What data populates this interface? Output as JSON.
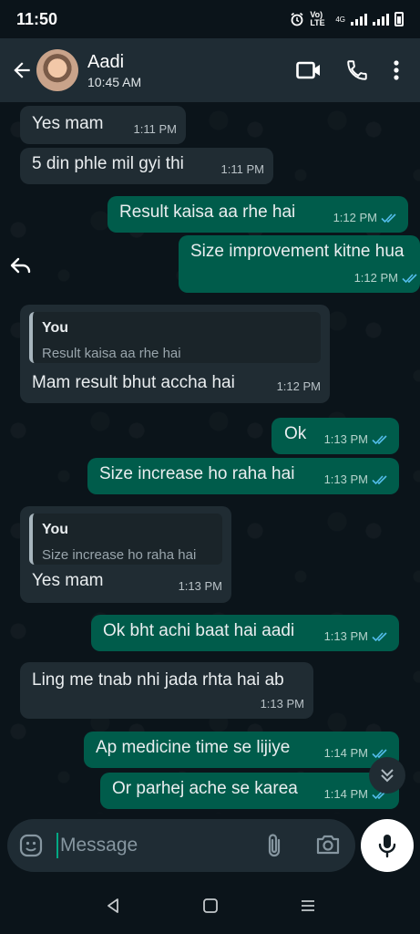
{
  "status_bar": {
    "time": "11:50",
    "network_label": "Vo) LTE",
    "network_type": "4G"
  },
  "header": {
    "contact_name": "Aadi",
    "last_seen": "10:45 AM"
  },
  "messages": [
    {
      "dir": "in",
      "text": "Yes mam",
      "time": "1:11 PM"
    },
    {
      "dir": "in",
      "text": "5 din phle mil gyi thi",
      "time": "1:11 PM"
    },
    {
      "dir": "out",
      "text": "Result kaisa aa rhe hai",
      "time": "1:12 PM",
      "read": true
    },
    {
      "dir": "out",
      "text": "Size improvement kitne hua",
      "time": "1:12 PM",
      "read": true
    },
    {
      "dir": "in",
      "quote_author": "You",
      "quote_text": "Result kaisa aa rhe hai",
      "text": "Mam result bhut accha hai",
      "time": "1:12 PM"
    },
    {
      "dir": "out",
      "text": "Ok",
      "time": "1:13 PM",
      "read": true
    },
    {
      "dir": "out",
      "text": "Size increase ho raha hai",
      "time": "1:13 PM",
      "read": true
    },
    {
      "dir": "in",
      "quote_author": "You",
      "quote_text": "Size increase ho raha hai",
      "text": "Yes mam",
      "time": "1:13 PM"
    },
    {
      "dir": "out",
      "text": "Ok bht achi baat hai aadi",
      "time": "1:13 PM",
      "read": true
    },
    {
      "dir": "in",
      "text": "Ling me tnab nhi jada rhta hai ab",
      "time": "1:13 PM"
    },
    {
      "dir": "out",
      "text": "Ap medicine time se lijiye",
      "time": "1:14 PM",
      "read": true
    },
    {
      "dir": "out",
      "text": "Or parhej ache se karea",
      "time": "1:14 PM",
      "read": true
    }
  ],
  "composer": {
    "placeholder": "Message"
  },
  "colors": {
    "incoming": "#202c33",
    "outgoing": "#005c4b",
    "read_ticks": "#53bdeb",
    "accent": "#00a884"
  },
  "icons": [
    "back-arrow-icon",
    "video-call-icon",
    "phone-icon",
    "more-vert-icon",
    "reply-icon",
    "scroll-down-icon",
    "emoji-icon",
    "attach-icon",
    "camera-icon",
    "mic-icon",
    "nav-back-icon",
    "nav-home-icon",
    "nav-recents-icon"
  ]
}
